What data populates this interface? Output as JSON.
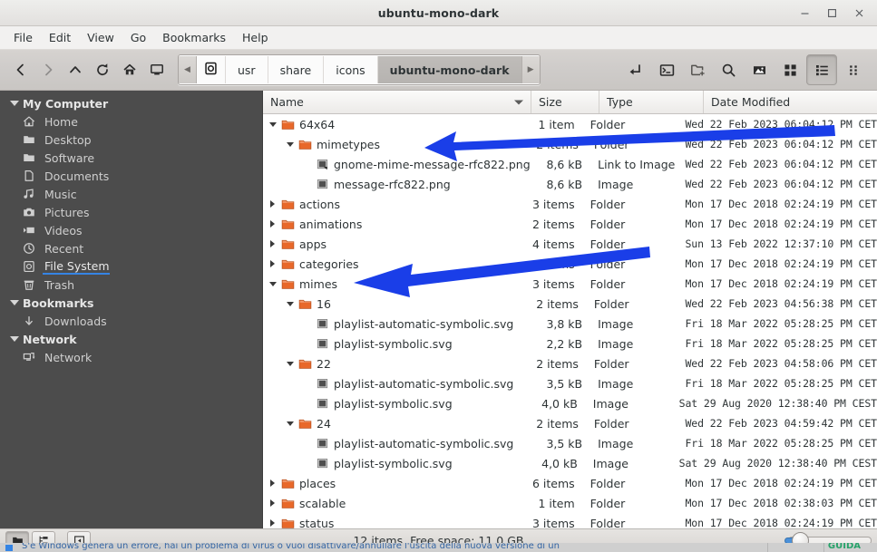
{
  "window": {
    "title": "ubuntu-mono-dark",
    "controls": [
      {
        "name": "minimize-button",
        "glyph": "minimize"
      },
      {
        "name": "maximize-button",
        "glyph": "maximize"
      },
      {
        "name": "close-button",
        "glyph": "close"
      }
    ]
  },
  "menubar": {
    "items": [
      "File",
      "Edit",
      "View",
      "Go",
      "Bookmarks",
      "Help"
    ]
  },
  "toolbar": {
    "nav": [
      {
        "name": "back-button",
        "icon": "chevron-left-icon",
        "disabled": false
      },
      {
        "name": "forward-button",
        "icon": "chevron-right-icon",
        "disabled": true
      },
      {
        "name": "up-button",
        "icon": "chevron-up-icon",
        "disabled": false
      },
      {
        "name": "reload-button",
        "icon": "reload-icon",
        "disabled": false
      },
      {
        "name": "home-button",
        "icon": "home-icon",
        "disabled": false
      },
      {
        "name": "computer-button",
        "icon": "monitor-icon",
        "disabled": false
      }
    ],
    "breadcrumb": {
      "scroll_left": "◀",
      "scroll_right": "▶",
      "items": [
        {
          "label": "",
          "icon": "filesystem-icon",
          "current": false
        },
        {
          "label": "usr",
          "icon": "",
          "current": false
        },
        {
          "label": "share",
          "icon": "",
          "current": false
        },
        {
          "label": "icons",
          "icon": "",
          "current": false
        },
        {
          "label": "ubuntu-mono-dark",
          "icon": "",
          "current": true
        }
      ]
    },
    "right": [
      {
        "name": "open-terminal-here-button",
        "icon": "arrow-enter-icon",
        "active": false
      },
      {
        "name": "terminal-button",
        "icon": "terminal-icon",
        "active": false
      },
      {
        "name": "new-folder-button",
        "icon": "folder-add-icon",
        "active": false
      },
      {
        "name": "search-button",
        "icon": "search-icon",
        "active": false
      },
      {
        "name": "preview-button",
        "icon": "image-icon",
        "active": false
      },
      {
        "name": "icon-view-button",
        "icon": "grid-view-icon",
        "active": false
      },
      {
        "name": "list-view-button",
        "icon": "list-view-icon",
        "active": true
      },
      {
        "name": "compact-view-button",
        "icon": "compact-view-icon",
        "active": false
      }
    ]
  },
  "sidebar": {
    "sections": [
      {
        "name": "My Computer",
        "expanded": true,
        "items": [
          {
            "label": "Home",
            "icon": "home-icon",
            "selected": false
          },
          {
            "label": "Desktop",
            "icon": "folder-icon",
            "selected": false
          },
          {
            "label": "Software",
            "icon": "folder-icon",
            "selected": false
          },
          {
            "label": "Documents",
            "icon": "document-icon",
            "selected": false
          },
          {
            "label": "Music",
            "icon": "music-icon",
            "selected": false
          },
          {
            "label": "Pictures",
            "icon": "camera-icon",
            "selected": false
          },
          {
            "label": "Videos",
            "icon": "video-icon",
            "selected": false
          },
          {
            "label": "Recent",
            "icon": "clock-icon",
            "selected": false
          },
          {
            "label": "File System",
            "icon": "filesystem-icon",
            "selected": true
          },
          {
            "label": "Trash",
            "icon": "trash-icon",
            "selected": false
          }
        ]
      },
      {
        "name": "Bookmarks",
        "expanded": true,
        "items": [
          {
            "label": "Downloads",
            "icon": "download-icon",
            "selected": false
          }
        ]
      },
      {
        "name": "Network",
        "expanded": true,
        "items": [
          {
            "label": "Network",
            "icon": "network-icon",
            "selected": false
          }
        ]
      }
    ]
  },
  "filelist": {
    "columns": [
      {
        "label": "Name",
        "sorted": true
      },
      {
        "label": "Size",
        "sorted": false
      },
      {
        "label": "Type",
        "sorted": false
      },
      {
        "label": "Date Modified",
        "sorted": false
      }
    ],
    "rows": [
      {
        "name": "64x64",
        "indent": 0,
        "twisty": "down",
        "icon": "folder-icon",
        "size": "1 item",
        "type": "Folder",
        "date": "Wed 22 Feb 2023 06:04:12 PM CET"
      },
      {
        "name": "mimetypes",
        "indent": 1,
        "twisty": "down",
        "icon": "folder-icon",
        "size": "2 items",
        "type": "Folder",
        "date": "Wed 22 Feb 2023 06:04:12 PM CET"
      },
      {
        "name": "gnome-mime-message-rfc822.png",
        "indent": 2,
        "twisty": "none",
        "icon": "image-link-icon",
        "size": "8,6 kB",
        "type": "Link to Image",
        "date": "Wed 22 Feb 2023 06:04:12 PM CET"
      },
      {
        "name": "message-rfc822.png",
        "indent": 2,
        "twisty": "none",
        "icon": "image-file-icon",
        "size": "8,6 kB",
        "type": "Image",
        "date": "Wed 22 Feb 2023 06:04:12 PM CET"
      },
      {
        "name": "actions",
        "indent": 0,
        "twisty": "right",
        "icon": "folder-icon",
        "size": "3 items",
        "type": "Folder",
        "date": "Mon 17 Dec 2018 02:24:19 PM CET"
      },
      {
        "name": "animations",
        "indent": 0,
        "twisty": "right",
        "icon": "folder-icon",
        "size": "2 items",
        "type": "Folder",
        "date": "Mon 17 Dec 2018 02:24:19 PM CET"
      },
      {
        "name": "apps",
        "indent": 0,
        "twisty": "right",
        "icon": "folder-icon",
        "size": "4 items",
        "type": "Folder",
        "date": "Sun 13 Feb 2022 12:37:10 PM CET"
      },
      {
        "name": "categories",
        "indent": 0,
        "twisty": "right",
        "icon": "folder-icon",
        "size": "items",
        "type": "Folder",
        "date": "Mon 17 Dec 2018 02:24:19 PM CET"
      },
      {
        "name": "mimes",
        "indent": 0,
        "twisty": "down",
        "icon": "folder-icon",
        "size": "3 items",
        "type": "Folder",
        "date": "Mon 17 Dec 2018 02:24:19 PM CET"
      },
      {
        "name": "16",
        "indent": 1,
        "twisty": "down",
        "icon": "folder-icon",
        "size": "2 items",
        "type": "Folder",
        "date": "Wed 22 Feb 2023 04:56:38 PM CET"
      },
      {
        "name": "playlist-automatic-symbolic.svg",
        "indent": 2,
        "twisty": "none",
        "icon": "image-file-icon",
        "size": "3,8 kB",
        "type": "Image",
        "date": "Fri 18 Mar 2022 05:28:25 PM CET"
      },
      {
        "name": "playlist-symbolic.svg",
        "indent": 2,
        "twisty": "none",
        "icon": "image-file-icon",
        "size": "2,2 kB",
        "type": "Image",
        "date": "Fri 18 Mar 2022 05:28:25 PM CET"
      },
      {
        "name": "22",
        "indent": 1,
        "twisty": "down",
        "icon": "folder-icon",
        "size": "2 items",
        "type": "Folder",
        "date": "Wed 22 Feb 2023 04:58:06 PM CET"
      },
      {
        "name": "playlist-automatic-symbolic.svg",
        "indent": 2,
        "twisty": "none",
        "icon": "image-file-icon",
        "size": "3,5 kB",
        "type": "Image",
        "date": "Fri 18 Mar 2022 05:28:25 PM CET"
      },
      {
        "name": "playlist-symbolic.svg",
        "indent": 2,
        "twisty": "none",
        "icon": "image-file-icon",
        "size": "4,0 kB",
        "type": "Image",
        "date": "Sat 29 Aug 2020 12:38:40 PM CEST"
      },
      {
        "name": "24",
        "indent": 1,
        "twisty": "down",
        "icon": "folder-icon",
        "size": "2 items",
        "type": "Folder",
        "date": "Wed 22 Feb 2023 04:59:42 PM CET"
      },
      {
        "name": "playlist-automatic-symbolic.svg",
        "indent": 2,
        "twisty": "none",
        "icon": "image-file-icon",
        "size": "3,5 kB",
        "type": "Image",
        "date": "Fri 18 Mar 2022 05:28:25 PM CET"
      },
      {
        "name": "playlist-symbolic.svg",
        "indent": 2,
        "twisty": "none",
        "icon": "image-file-icon",
        "size": "4,0 kB",
        "type": "Image",
        "date": "Sat 29 Aug 2020 12:38:40 PM CEST"
      },
      {
        "name": "places",
        "indent": 0,
        "twisty": "right",
        "icon": "folder-icon",
        "size": "6 items",
        "type": "Folder",
        "date": "Mon 17 Dec 2018 02:24:19 PM CET"
      },
      {
        "name": "scalable",
        "indent": 0,
        "twisty": "right",
        "icon": "folder-icon",
        "size": "1 item",
        "type": "Folder",
        "date": "Mon 17 Dec 2018 02:38:03 PM CET"
      },
      {
        "name": "status",
        "indent": 0,
        "twisty": "right",
        "icon": "folder-icon",
        "size": "3 items",
        "type": "Folder",
        "date": "Mon 17 Dec 2018 02:24:19 PM CET"
      }
    ]
  },
  "statusbar": {
    "buttons": [
      {
        "name": "icon-view-toggle",
        "icon": "folder-view-icon",
        "active": true
      },
      {
        "name": "tree-view-toggle",
        "icon": "tree-view-icon",
        "active": false
      },
      {
        "name": "toggle-sidebar-button",
        "icon": "sidebar-toggle-icon",
        "active": false
      }
    ],
    "text": "12 items, Free space: 11,0 GB",
    "zoom_value": 10
  },
  "annotations": {
    "arrows": [
      {
        "name": "arrow-pointing-to-mimetypes",
        "color": "#1a3ee8"
      },
      {
        "name": "arrow-pointing-to-mimes",
        "color": "#1a3ee8"
      }
    ],
    "color": "#1a3ee8"
  },
  "background_window": {
    "left_text": "S'e Windows genera un errore, hai un problema di virus o vuoi disattivare/annullare l'uscita della nuova versione di un",
    "right_text": "12 items, Free spa",
    "badge": "GUIDA"
  }
}
